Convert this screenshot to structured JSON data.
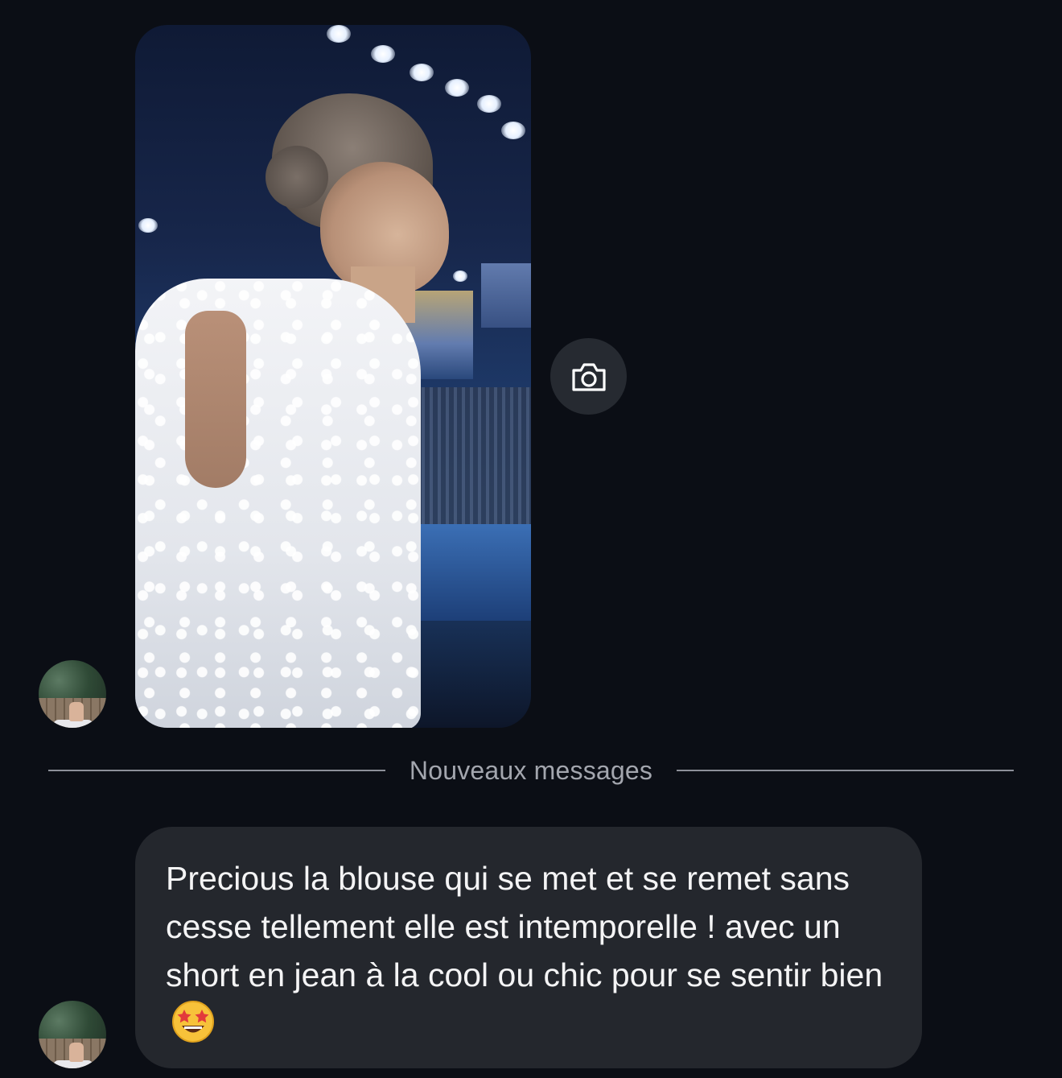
{
  "photo_message": {
    "alt": "woman-in-white-lace-blouse-photo",
    "camera_icon": "camera-icon"
  },
  "divider": {
    "label": "Nouveaux messages"
  },
  "message": {
    "text": "Precious la blouse qui se met et se remet sans cesse tellement elle est intemporelle ! avec un short en jean à la cool ou chic pour se sentir bien",
    "emoji": "star-struck-emoji"
  },
  "avatars": [
    {
      "icon": "avatar-feet-on-deck"
    },
    {
      "icon": "avatar-feet-on-deck"
    }
  ],
  "colors": {
    "background": "#0b0e15",
    "bubble": "#24272d",
    "divider_line": "#8d9099",
    "divider_text": "#a3a6ae",
    "camera_button": "#262a31"
  }
}
